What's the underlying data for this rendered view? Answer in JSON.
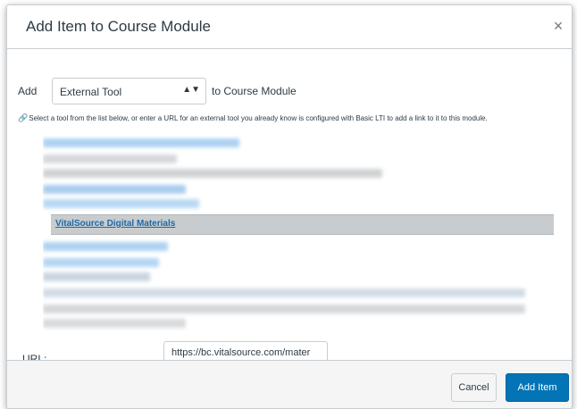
{
  "dialog": {
    "title": "Add Item to Course Module",
    "close_icon": "close-icon",
    "close_glyph": "×"
  },
  "form": {
    "add_label": "Add",
    "item_type": "External Tool",
    "suffix": "to Course Module",
    "hint": "Select a tool from the list below, or enter a URL for an external tool you already know is configured with Basic LTI to add a link to it to this module.",
    "hint_icon": "link-icon",
    "selected_tool": "VitalSource Digital Materials",
    "url_label": "URL:",
    "url_value": "https://bc.vitalsource.com/mater"
  },
  "footer": {
    "cancel_label": "Cancel",
    "add_label": "Add Item"
  },
  "colors": {
    "primary": "#0374b5",
    "link": "#1a6aa8",
    "selected_bg": "#c9ccce"
  }
}
